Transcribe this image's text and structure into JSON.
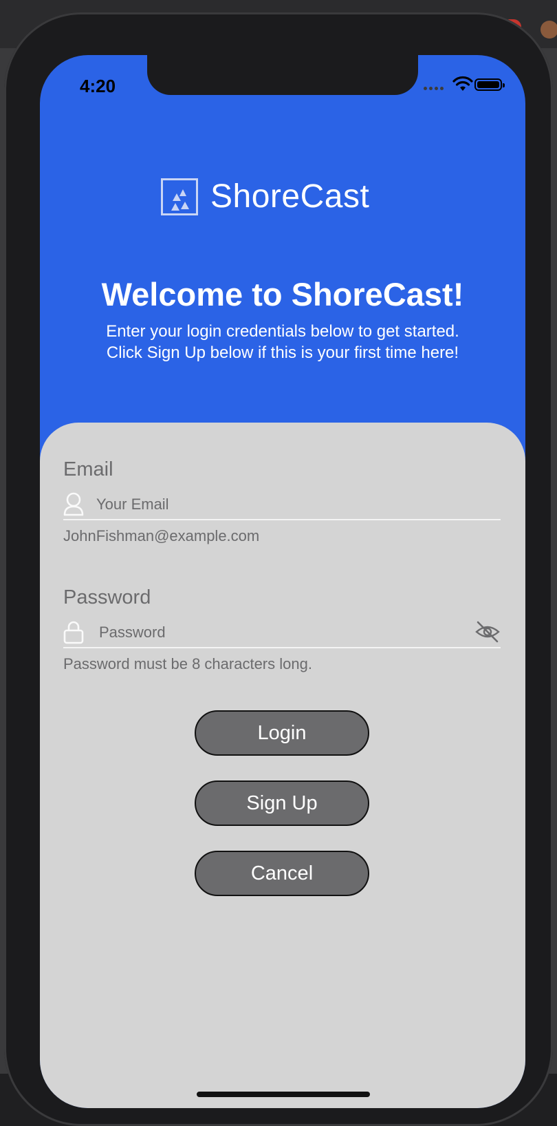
{
  "status_bar": {
    "time": "4:20"
  },
  "brand": {
    "name": "ShoreCast",
    "accent_color": "#2b63e6"
  },
  "header": {
    "title": "Welcome to ShoreCast!",
    "subtitle_line1": "Enter your login credentials below to get started.",
    "subtitle_line2": "Click Sign Up below if this is your first time here!"
  },
  "form": {
    "email": {
      "label": "Email",
      "placeholder": "Your Email",
      "value": "",
      "helper": "JohnFishman@example.com"
    },
    "password": {
      "label": "Password",
      "placeholder": "Password",
      "value": "",
      "helper": "Password must be 8 characters long."
    }
  },
  "buttons": {
    "login": "Login",
    "signup": "Sign Up",
    "cancel": "Cancel"
  },
  "icons": {
    "email_icon": "user-icon",
    "password_icon": "lock-icon",
    "visibility_icon": "eye-off-icon",
    "status_icons": [
      "cellular-signal-icon",
      "wifi-icon",
      "battery-icon"
    ]
  }
}
